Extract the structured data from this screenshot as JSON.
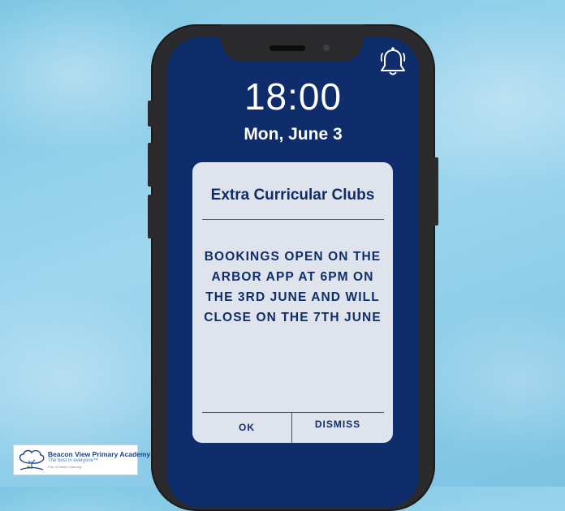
{
  "lockscreen": {
    "time": "18:00",
    "date": "Mon, June 3"
  },
  "status": {
    "icon": "bell-icon"
  },
  "notification": {
    "title": "Extra Curricular Clubs",
    "body": "BOOKINGS OPEN ON THE ARBOR APP AT 6PM ON THE 3RD JUNE AND WILL CLOSE ON THE 7TH JUNE",
    "actions": {
      "ok_label": "OK",
      "dismiss_label": "DISMISS"
    }
  },
  "branding": {
    "school_name": "Beacon View Primary Academy",
    "tagline": "The best in everyone™",
    "subline": "Part of United Learning",
    "logo_icon": "tree-logo-icon"
  },
  "colors": {
    "screen_bg": "#0f2d6b",
    "card_bg": "#dfe3ec",
    "text_primary": "#0f2d6b",
    "backdrop": "#8fcfea"
  }
}
